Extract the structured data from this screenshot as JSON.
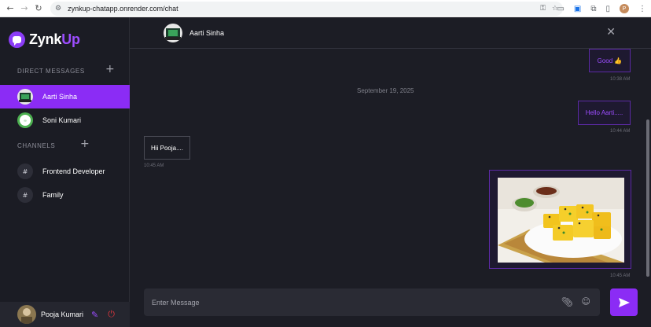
{
  "browser": {
    "url": "zynkup-chatapp.onrender.com/chat",
    "profile_initial": "P"
  },
  "app": {
    "name_primary": "Zynk",
    "name_accent": "Up",
    "brand_color": "#8b2cf5"
  },
  "sidebar": {
    "dm_title": "DIRECT MESSAGES",
    "channels_title": "CHANNELS",
    "contacts": [
      {
        "label": "Aarti Sinha",
        "active": true
      },
      {
        "label": "Soni Kumari",
        "active": false
      }
    ],
    "channels": [
      {
        "label": "Frontend Developer",
        "hash": "#"
      },
      {
        "label": "Family",
        "hash": "#"
      }
    ],
    "user": {
      "name": "Pooja Kumari"
    }
  },
  "chat": {
    "contact_name": "Aarti Sinha",
    "date_separator": "September 19, 2025",
    "messages": [
      {
        "text": "Good 👍",
        "time": "10:38 AM",
        "direction": "out"
      },
      {
        "text": "Hello Aarti.....",
        "time": "10:44 AM",
        "direction": "out"
      },
      {
        "text": "Hii Pooja....",
        "time": "10:45 AM",
        "direction": "in"
      },
      {
        "text": "",
        "time": "10:45 AM",
        "direction": "out",
        "attachment": "food-photo"
      }
    ]
  },
  "composer": {
    "placeholder": "Enter Message"
  },
  "icons": [
    "back-icon",
    "forward-icon",
    "reload-icon",
    "site-settings-icon",
    "key-icon",
    "star-icon",
    "close-icon",
    "paperclip-icon",
    "emoji-icon",
    "send-icon",
    "edit-icon",
    "power-icon",
    "plus-icon"
  ]
}
